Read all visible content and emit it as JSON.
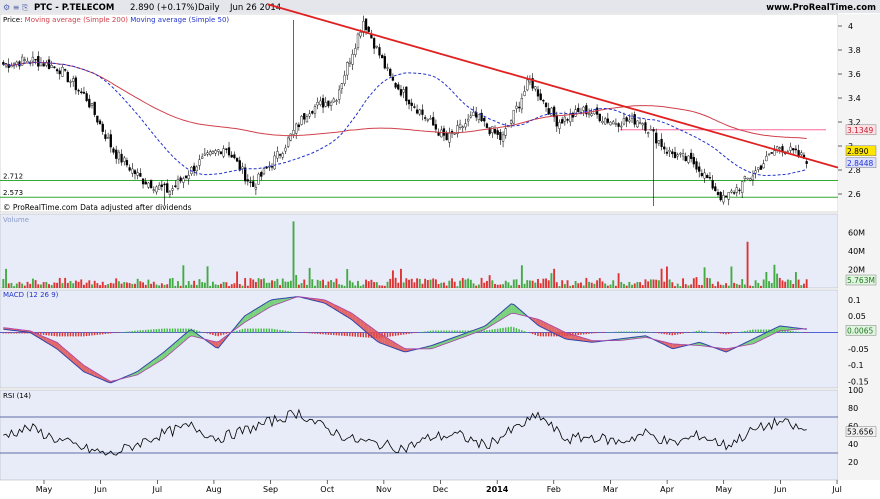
{
  "header": {
    "symbol": "PTC - P.TELECOM",
    "quote": "2.890 (+0.17%)",
    "period": "Daily",
    "date": "Jun 26 2014",
    "site": "www.ProRealTime.com"
  },
  "legend": {
    "price": "Price",
    "ma200": "Moving average (Simple 200)",
    "ma50": "Moving average (Simple 50)",
    "copyright": "© ProRealTime.com",
    "adjust_note": "Data adjusted after dividends"
  },
  "colors": {
    "up_candle": "#ffffff",
    "down_candle": "#000000",
    "ma200": "#d0404a",
    "ma50": "#2233cc",
    "trendline": "#e02020",
    "support": "#33aa33",
    "resistance": "#ff6699",
    "macd_pos": "#44bb44",
    "macd_neg": "#dd3333",
    "panel_bg": "#e8ecf8"
  },
  "chart_data": [
    {
      "type": "candlestick",
      "title": "PTC - P.TELECOM",
      "ylim": [
        2.45,
        4.1
      ],
      "yticks": [
        "4",
        "3.8",
        "3.6",
        "3.4",
        "3.2",
        "3",
        "2.8",
        "2.6"
      ],
      "x_labels": [
        "May",
        "Jun",
        "Jul",
        "Aug",
        "Sep",
        "Oct",
        "Nov",
        "Dec",
        "2014",
        "Feb",
        "Mar",
        "Apr",
        "May",
        "Jun",
        "Jul"
      ],
      "price_path": [
        [
          "Apr 2013",
          3.68
        ],
        [
          "May",
          3.72
        ],
        [
          "late May",
          3.65
        ],
        [
          "Jun",
          3.4
        ],
        [
          "late Jun",
          2.95
        ],
        [
          "Jul",
          2.72
        ],
        [
          "mid Jul",
          2.62
        ],
        [
          "Aug",
          2.85
        ],
        [
          "mid Aug",
          3.0
        ],
        [
          "late Aug",
          2.66
        ],
        [
          "Sep",
          2.95
        ],
        [
          "mid Sep",
          3.3
        ],
        [
          "Oct",
          3.4
        ],
        [
          "Oct high",
          4.05
        ],
        [
          "mid Oct",
          3.55
        ],
        [
          "Nov",
          3.3
        ],
        [
          "mid Nov",
          3.05
        ],
        [
          "Dec",
          3.25
        ],
        [
          "late Dec",
          3.05
        ],
        [
          "Jan 2014",
          3.55
        ],
        [
          "Feb",
          3.2
        ],
        [
          "mid Feb",
          3.3
        ],
        [
          "Mar",
          3.2
        ],
        [
          "Apr",
          3.22
        ],
        [
          "mid Apr",
          2.95
        ],
        [
          "May",
          2.85
        ],
        [
          "mid May",
          2.55
        ],
        [
          "late May",
          2.75
        ],
        [
          "Jun",
          3.0
        ],
        [
          "Jun 26 2014",
          2.89
        ]
      ],
      "annotations": {
        "last_price": "2.890",
        "ma200_last": "3.1349",
        "ma50_last": "2.8448",
        "level_1": "2.712",
        "level_2": "2.573"
      }
    },
    {
      "type": "bar",
      "title": "Volume",
      "yticks": [
        "60M",
        "40M",
        "20M"
      ],
      "last_value": "5.763M",
      "spikes": [
        [
          "Oct 2013",
          72
        ],
        [
          "Jun 2014",
          50
        ]
      ]
    },
    {
      "type": "area",
      "title": "MACD (12 26 9)",
      "yticks": [
        "0.1",
        "0.05",
        "0",
        "-0.05",
        "-0.1",
        "-0.15"
      ],
      "ylim": [
        -0.17,
        0.13
      ],
      "series": [
        {
          "name": "MACD",
          "path": [
            0.01,
            0.0,
            -0.05,
            -0.12,
            -0.155,
            -0.12,
            -0.06,
            0.01,
            -0.05,
            0.05,
            0.1,
            0.11,
            0.09,
            0.04,
            -0.03,
            -0.06,
            -0.04,
            -0.01,
            0.02,
            0.09,
            0.02,
            -0.02,
            -0.03,
            -0.02,
            -0.01,
            -0.05,
            -0.03,
            -0.06,
            -0.02,
            0.02,
            0.01
          ]
        },
        {
          "name": "Signal",
          "path": [
            0.015,
            0.005,
            -0.03,
            -0.1,
            -0.15,
            -0.13,
            -0.08,
            -0.01,
            -0.03,
            0.03,
            0.08,
            0.11,
            0.1,
            0.06,
            0.0,
            -0.05,
            -0.05,
            -0.02,
            0.01,
            0.06,
            0.04,
            0.0,
            -0.025,
            -0.025,
            -0.015,
            -0.035,
            -0.04,
            -0.05,
            -0.035,
            0.005,
            0.012
          ]
        }
      ],
      "last_value": "0.0065"
    },
    {
      "type": "line",
      "title": "RSI (14)",
      "yticks": [
        "100",
        "80",
        "60",
        "40",
        "20"
      ],
      "ylim": [
        0,
        100
      ],
      "levels": [
        70,
        30
      ],
      "series": [
        {
          "name": "RSI",
          "path": [
            50,
            58,
            45,
            35,
            28,
            40,
            52,
            60,
            46,
            55,
            65,
            75,
            58,
            45,
            40,
            35,
            48,
            50,
            38,
            55,
            72,
            45,
            48,
            42,
            52,
            40,
            50,
            38,
            55,
            65,
            53.656
          ]
        }
      ],
      "last_value": "53.656"
    }
  ]
}
